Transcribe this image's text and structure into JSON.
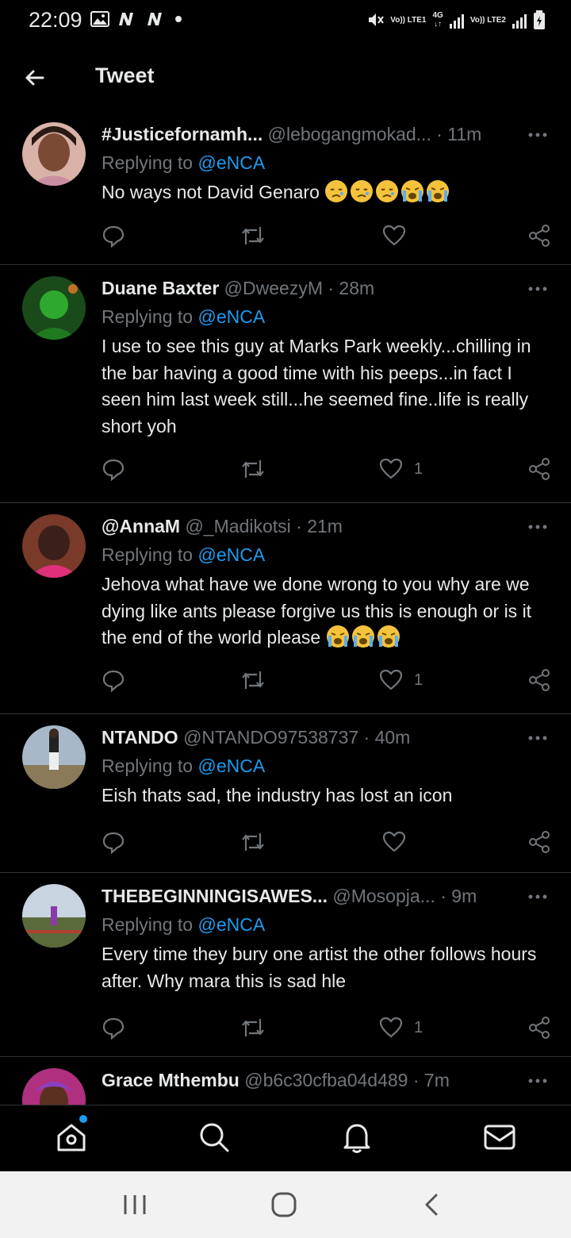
{
  "status_bar": {
    "time": "22:09",
    "sim1_label": "Vo)) LTE1",
    "net_label": "4G",
    "sim2_label": "Vo)) LTE2"
  },
  "header": {
    "title": "Tweet"
  },
  "reply_prefix": "Replying to",
  "tweets": [
    {
      "name": "#Justicefornamh...",
      "handle": "@lebogangmokad...",
      "time": "· 11m",
      "reply_to": "@eNCA",
      "text": "No ways not David Genaro",
      "emojis": [
        "sad-face",
        "sad-face",
        "sad-face",
        "crying-face",
        "crying-face"
      ],
      "likes": ""
    },
    {
      "name": "Duane Baxter",
      "handle": "@DweezyM",
      "time": "· 28m",
      "reply_to": "@eNCA",
      "text": "I use to see this guy at Marks Park weekly...chilling in the bar having a good time with his peeps...in fact I seen him last week still...he seemed fine..life is really short yoh",
      "emojis": [],
      "likes": "1"
    },
    {
      "name": "@AnnaM",
      "handle": "@_Madikotsi",
      "time": "· 21m",
      "reply_to": "@eNCA",
      "text": "Jehova what have we done wrong to you why are we dying like ants please forgive us this is enough or is it the end of the world please",
      "emojis": [
        "crying-face",
        "crying-face",
        "crying-face"
      ],
      "likes": "1"
    },
    {
      "name": "NTANDO",
      "handle": "@NTANDO97538737",
      "time": "· 40m",
      "reply_to": "@eNCA",
      "text": "Eish thats sad, the industry has lost an icon",
      "emojis": [],
      "likes": ""
    },
    {
      "name": "THEBEGINNINGISAWES...",
      "handle": "@Mosopja...",
      "time": "· 9m",
      "reply_to": "@eNCA",
      "text": "Every time they bury one artist the other follows hours after. Why mara this is sad hle",
      "emojis": [],
      "likes": "1"
    },
    {
      "name": "Grace Mthembu",
      "handle": "@b6c30cfba04d489",
      "time": "· 7m",
      "reply_to": "",
      "text": "",
      "emojis": [],
      "likes": ""
    }
  ],
  "colors": {
    "background": "#000000",
    "text": "#e7e9ea",
    "muted": "#71767b",
    "accent": "#1d9bf0",
    "divider": "#2f3336"
  },
  "bottom_nav": [
    "home-icon",
    "search-icon",
    "bell-icon",
    "mail-icon"
  ],
  "system_nav": [
    "recents-icon",
    "home-circle-icon",
    "back-chevron-icon"
  ]
}
